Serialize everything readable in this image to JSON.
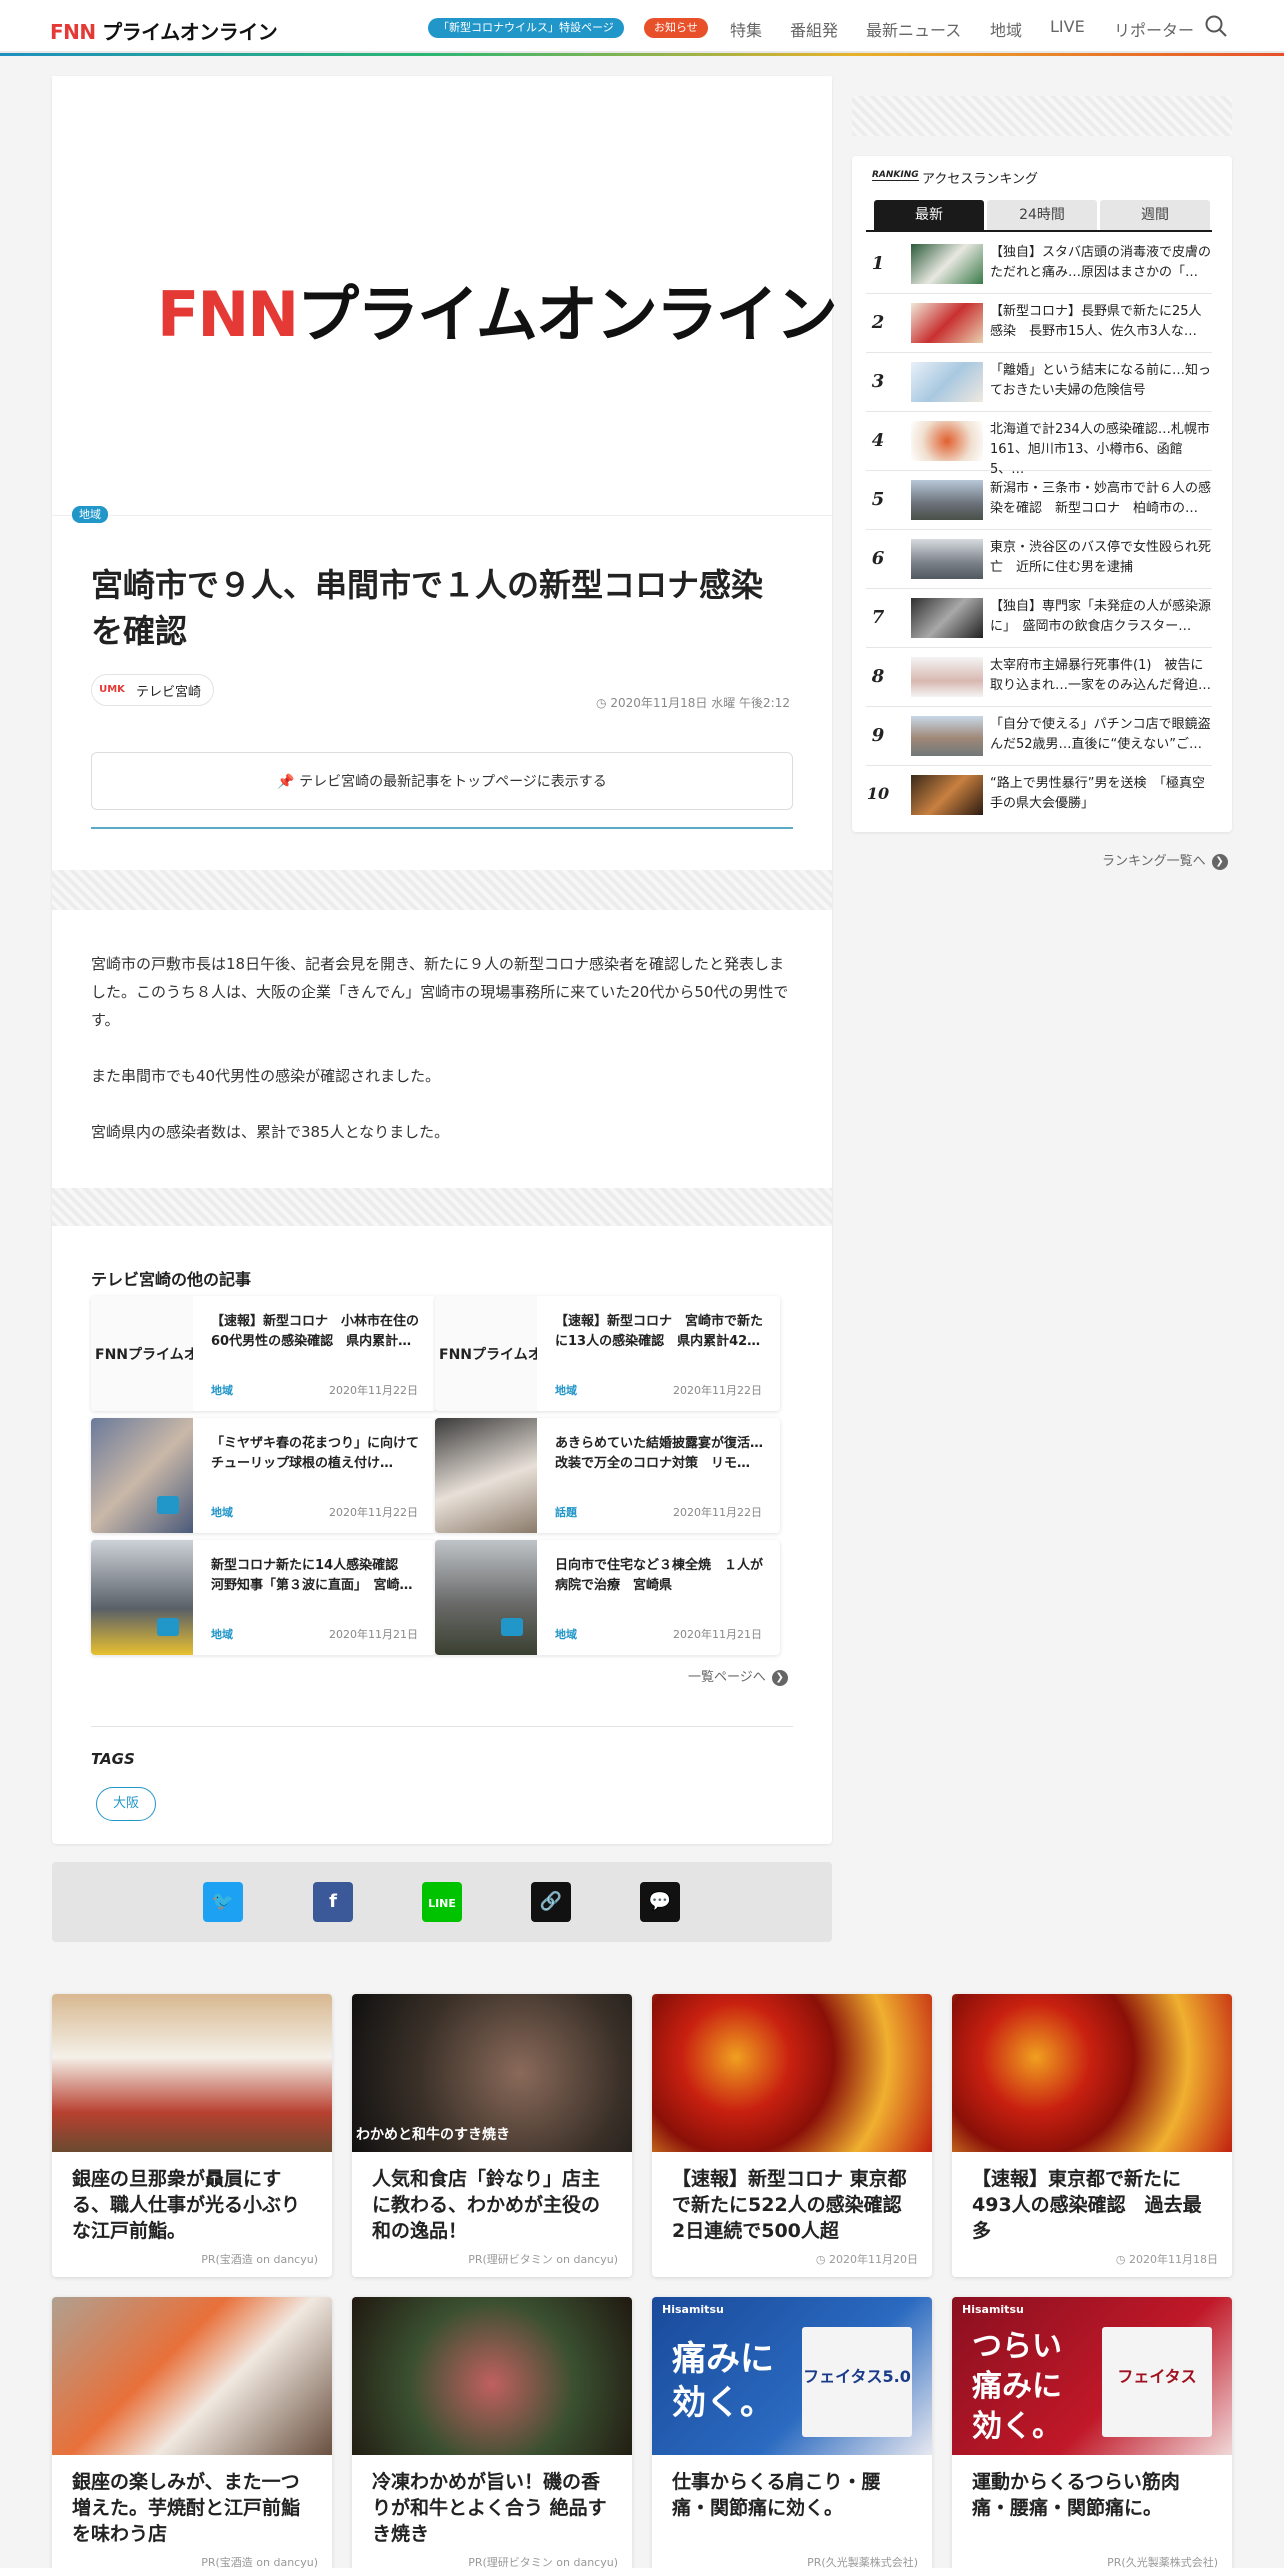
{
  "header": {
    "logo_fnn": "FNN",
    "logo_text": "プライムオンライン",
    "special_link": "「新型コロナウイルス」特設ページ",
    "notice_link": "お知らせ",
    "nav": [
      "特集",
      "番組発",
      "最新ニュース",
      "地域",
      "LIVE",
      "リポーター"
    ],
    "colors": {
      "special": "#2196c9",
      "notice": "#e8502a"
    }
  },
  "article": {
    "hero_logo_fnn": "FNN",
    "hero_logo_text": "プライムオンライン",
    "category": "地域",
    "title": "宮崎市で９人、串間市で１人の新型コロナ感染を確認",
    "source_logo": "UMK",
    "source_name": "テレビ宮崎",
    "date": "2020年11月18日 水曜 午後2:12",
    "follow_button": "テレビ宮崎の最新記事をトップページに表示する",
    "paragraphs": [
      "宮崎市の戸敷市長は18日午後、記者会見を開き、新たに９人の新型コロナ感染者を確認したと発表しました。このうち８人は、大阪の企業「きんでん」宮崎市の現場事務所に来ていた20代から50代の男性です。",
      "また串間市でも40代男性の感染が確認されました。",
      "宮崎県内の感染者数は、累計で385人となりました。"
    ]
  },
  "other_articles": {
    "heading": "テレビ宮崎の他の記事",
    "items": [
      {
        "title": "【速報】新型コロナ　小林市在住の60代男性の感染確認　県内累計…",
        "category": "地域",
        "date": "2020年11月22日"
      },
      {
        "title": "【速報】新型コロナ　宮崎市で新たに13人の感染確認　県内累計42…",
        "category": "地域",
        "date": "2020年11月22日"
      },
      {
        "title": "「ミヤザキ春の花まつり」に向けて　チューリップ球根の植え付け…",
        "category": "地域",
        "date": "2020年11月22日"
      },
      {
        "title": "あきらめていた結婚披露宴が復活…改装で万全のコロナ対策　リモ…",
        "category": "話題",
        "date": "2020年11月22日"
      },
      {
        "title": "新型コロナ新たに14人感染確認　河野知事「第３波に直面」　宮崎…",
        "category": "地域",
        "date": "2020年11月21日"
      },
      {
        "title": "日向市で住宅など３棟全焼　１人が病院で治療　宮崎県",
        "category": "地域",
        "date": "2020年11月21日"
      }
    ],
    "mini_logo": "FNNプライムオンライン",
    "more": "一覧ページへ"
  },
  "tags": {
    "heading": "TAGS",
    "items": [
      "大阪"
    ]
  },
  "share": [
    "twitter",
    "facebook",
    "line",
    "link",
    "comment"
  ],
  "ranking": {
    "label_en": "RANKING",
    "label": "アクセスランキング",
    "tabs": [
      "最新",
      "24時間",
      "週間"
    ],
    "items": [
      {
        "rank": "1",
        "title": "【独自】スタバ店頭の消毒液で皮膚のただれと痛み…原因はまさかの「…"
      },
      {
        "rank": "2",
        "title": "【新型コロナ】長野県で新たに25人感染　長野市15人、佐久市3人な…"
      },
      {
        "rank": "3",
        "title": "「離婚」という結末になる前に…知っておきたい夫婦の危険信号"
      },
      {
        "rank": "4",
        "title": "北海道で計234人の感染確認…札幌市161、旭川市13、小樽市6、函館5、…"
      },
      {
        "rank": "5",
        "title": "新潟市・三条市・妙高市で計６人の感染を確認　新型コロナ　柏崎市の…"
      },
      {
        "rank": "6",
        "title": "東京・渋谷区のバス停で女性殴られ死亡　近所に住む男を逮捕"
      },
      {
        "rank": "7",
        "title": "【独自】専門家「未発症の人が感染源に」　盛岡市の飲食店クラスター…"
      },
      {
        "rank": "8",
        "title": "太宰府市主婦暴行死事件(1)　被告に取り込まれ…一家をのみ込んだ脅迫…"
      },
      {
        "rank": "9",
        "title": "「自分で使える」パチンコ店で眼鏡盗んだ52歳男…直後に“使えない”ご…"
      },
      {
        "rank": "10",
        "title": "“路上で男性暴行”男を送検　「極真空手の県大会優勝」"
      }
    ],
    "more": "ランキング一覧へ"
  },
  "bottom_cards": [
    {
      "title": "銀座の旦那衆が贔屓にする、職人仕事が光る小ぶりな江戸前鮨。",
      "source": "PR(宝酒造 on dancyu)",
      "image": "sushi-chefs"
    },
    {
      "title": "人気和食店「鈴なり」店主に教わる、わかめが主役の和の逸品！",
      "source": "PR(理研ビタミン on dancyu)",
      "image": "sukiyaki",
      "image_caption": "わかめと和牛のすき焼き"
    },
    {
      "title": "【速報】新型コロナ 東京都で新たに522人の感染確認　2日連続で500人超",
      "source": "2020年11月20日",
      "image": "virus"
    },
    {
      "title": "【速報】東京都で新たに493人の感染確認　過去最多",
      "source": "2020年11月18日",
      "image": "virus"
    },
    {
      "title": "銀座の楽しみが、また一つ増えた。芋焼酎と江戸前鮨を味わう店",
      "source": "PR(宝酒造 on dancyu)",
      "image": "sushi-plate"
    },
    {
      "title": "冷凍わかめが旨い！磯の香りが和牛とよく合う 絶品すき焼き",
      "source": "PR(理研ビタミン on dancyu)",
      "image": "sukiyaki-pot"
    },
    {
      "title": "仕事からくる肩こり・腰痛・関節痛に効く。",
      "source": "PR(久光製薬株式会社)",
      "image": "feitas-blue",
      "image_text": "痛みに効く。",
      "brand": "Hisamitsu",
      "product": "フェイタス5.0"
    },
    {
      "title": "運動からくるつらい筋肉痛・腰痛・関節痛に。",
      "source": "PR(久光製薬株式会社)",
      "image": "feitas-red",
      "image_text": "つらい痛みに効く。",
      "brand": "Hisamitsu",
      "product": "フェイタス"
    }
  ]
}
